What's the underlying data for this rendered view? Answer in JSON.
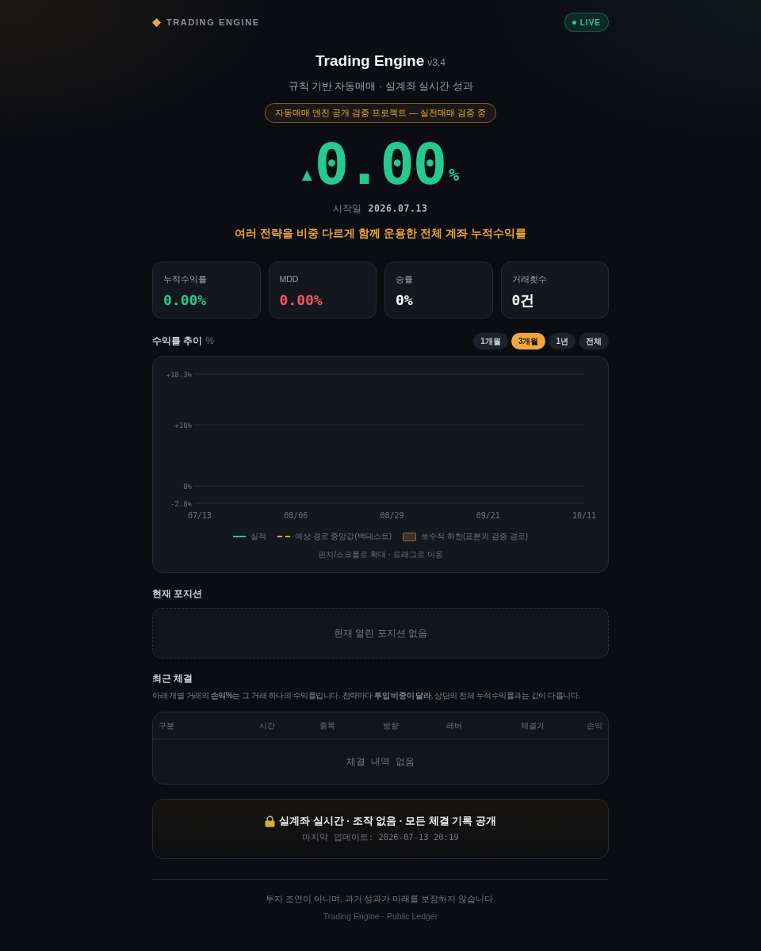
{
  "header": {
    "brand": "TRADING ENGINE",
    "status": {
      "label": "LIVE",
      "on": true
    }
  },
  "hero": {
    "title": "Trading Engine",
    "version": "v3.4",
    "subtitle": "규칙 기반 자동매매 · 실계좌 실시간 성과",
    "badge": "자동매매 엔진 공개 검증 프로젝트 — 실전매매 검증 중",
    "return": {
      "arrow": "▲",
      "value": "0.00",
      "unit": "%"
    },
    "start": {
      "label": "시작일",
      "date": "2026.07.13"
    },
    "caption": "여러 전략을 비중 다르게 함께 운용한 **전체 계좌** 누적수익률"
  },
  "stats": [
    {
      "label": "누적수익률",
      "value": "0.00%",
      "color": "#26c98f"
    },
    {
      "label": "MDD",
      "value": "0.00%",
      "color": "#ef5b5b"
    },
    {
      "label": "승률",
      "value": "0%",
      "color": "#ffffff"
    },
    {
      "label": "거래횟수",
      "value": "0건",
      "color": "#ffffff"
    }
  ],
  "chart": {
    "title": "수익률 추이",
    "unit": "%",
    "ranges": [
      {
        "label": "1개월",
        "selected": false
      },
      {
        "label": "3개월",
        "selected": true
      },
      {
        "label": "1년",
        "selected": false
      },
      {
        "label": "전체",
        "selected": false
      }
    ],
    "chart_data": {
      "type": "line",
      "categories": [
        "07/13",
        "08/06",
        "08/29",
        "09/21",
        "10/11"
      ],
      "ylim": [
        -2.8,
        18.3
      ],
      "yticks": [
        {
          "value": 18.3,
          "label": "+18.3%"
        },
        {
          "value": 10,
          "label": "+10%"
        },
        {
          "value": 0,
          "label": "0%"
        },
        {
          "value": -2.8,
          "label": "-2.8%"
        }
      ]
    },
    "legend": [
      {
        "kind": "line",
        "label": "실적",
        "color": "#26c98f"
      },
      {
        "kind": "dashed",
        "label": "예상 경로 중앙값(백테스트)",
        "color": "#f0a83a"
      },
      {
        "kind": "band",
        "label": "보수적 하한(표본외 검증 경로)",
        "color": "#8a6a3a"
      }
    ],
    "hint": "핀치/스크롤로 확대 · 드래그로 이동"
  },
  "positions": {
    "title": "현재 포지션",
    "empty_message": "현재 열린 포지션 없음"
  },
  "trades": {
    "title": "최근 체결",
    "note": "아래 개별 거래의 **손익%**는 그 거래 하나의 수익률입니다. 전략마다 **투입 비중이 달라**, 상단의 전체 누적수익률과는 값이 다릅니다.",
    "columns": [
      "구분",
      "시간",
      "종목",
      "방향",
      "레버",
      "체결가",
      "손익"
    ],
    "empty_message": "체결 내역 없음"
  },
  "ledger": {
    "title": "실계좌 실시간 · 조작 없음 · 모든 체결 기록 공개",
    "updated": "마지막 업데이트: 2026-07-13 20:19"
  },
  "footer": {
    "disclaimer": "투자 조언이 아니며, 과거 성과가 미래를 보장하지 않습니다.",
    "credit": "Trading Engine · Public Ledger"
  }
}
